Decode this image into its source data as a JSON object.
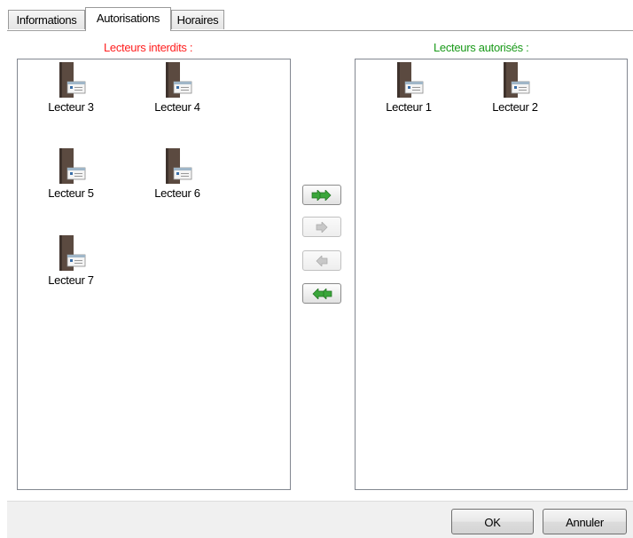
{
  "tabs": [
    {
      "label": "Informations",
      "active": false
    },
    {
      "label": "Autorisations",
      "active": true
    },
    {
      "label": "Horaires",
      "active": false
    }
  ],
  "forbidden_panel": {
    "title": "Lecteurs interdits :",
    "items": [
      {
        "label": "Lecteur 3",
        "icon": "card-reader-icon"
      },
      {
        "label": "Lecteur 4",
        "icon": "card-reader-icon"
      },
      {
        "label": "Lecteur 5",
        "icon": "card-reader-icon"
      },
      {
        "label": "Lecteur 6",
        "icon": "card-reader-icon"
      },
      {
        "label": "Lecteur 7",
        "icon": "card-reader-icon"
      }
    ]
  },
  "allowed_panel": {
    "title": "Lecteurs autorisés :",
    "items": [
      {
        "label": "Lecteur 1",
        "icon": "card-reader-icon"
      },
      {
        "label": "Lecteur 2",
        "icon": "card-reader-icon"
      }
    ]
  },
  "transfer_buttons": [
    {
      "icon": "double-arrow-right-icon",
      "enabled": true
    },
    {
      "icon": "arrow-right-icon",
      "enabled": false
    },
    {
      "icon": "arrow-left-icon",
      "enabled": false
    },
    {
      "icon": "double-arrow-left-icon",
      "enabled": true
    }
  ],
  "footer": {
    "ok_label": "OK",
    "cancel_label": "Annuler"
  },
  "colors": {
    "forbidden_title": "#ff2020",
    "allowed_title": "#1a9a1a",
    "arrow_enabled": "#3aa63a",
    "arrow_disabled": "#b8b8b8"
  }
}
